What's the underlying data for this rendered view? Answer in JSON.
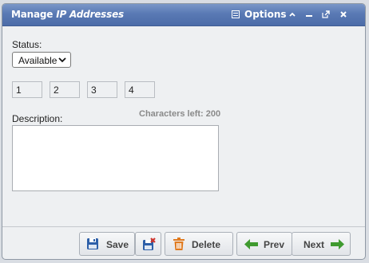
{
  "window": {
    "title_prefix": "Manage ",
    "title_italic": "IP Addresses",
    "options_label": "Options"
  },
  "form": {
    "status_label": "Status:",
    "status_value": "Available",
    "ip_octets": [
      "1",
      "2",
      "3",
      "4"
    ],
    "description_label": "Description:",
    "chars_left_label": "Characters left: 200",
    "description_value": ""
  },
  "buttons": {
    "save": "Save",
    "delete": "Delete",
    "prev": "Prev",
    "next": "Next"
  },
  "colors": {
    "titlebar": "#5979b4",
    "save_icon": "#2d5fa8",
    "delete_icon": "#e07a1f",
    "nav_arrow": "#3f9a2f",
    "cancel_x": "#d0342c"
  },
  "icons": {
    "options": "list-icon",
    "collapse": "chevron-up-icon",
    "minimize": "minimize-icon",
    "popout": "popout-icon",
    "close": "close-icon",
    "save": "floppy-disk-icon",
    "cancel_save": "floppy-cancel-icon",
    "delete": "trash-icon",
    "prev": "arrow-left-icon",
    "next": "arrow-right-icon"
  }
}
